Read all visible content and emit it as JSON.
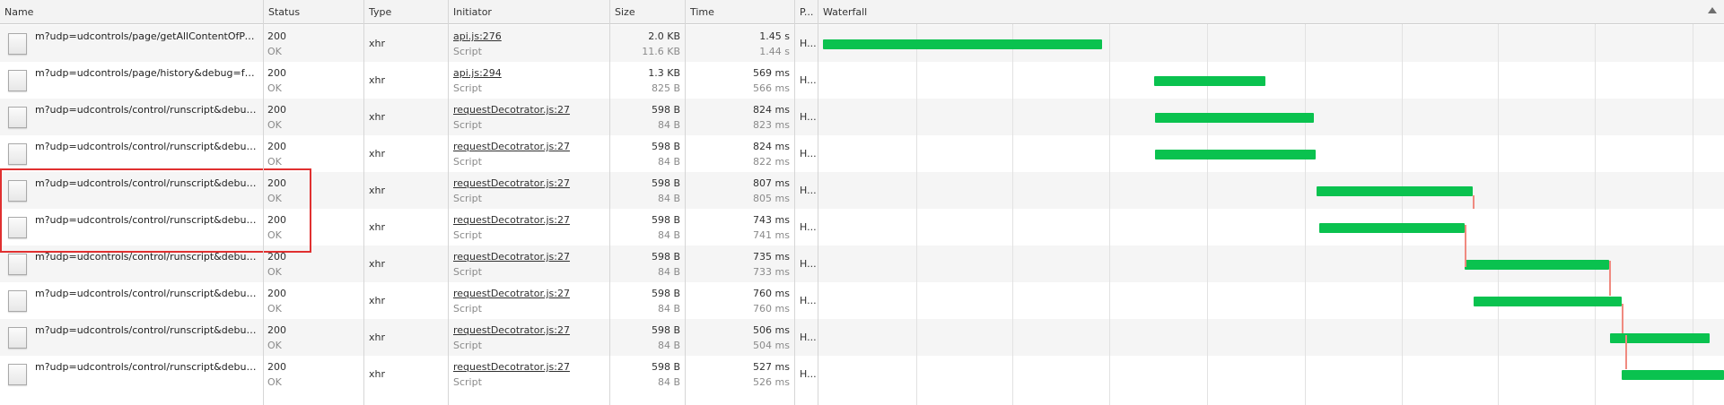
{
  "columns": {
    "name": "Name",
    "status": "Status",
    "type": "Type",
    "initiator": "Initiator",
    "size": "Size",
    "time": "Time",
    "priority": "P...",
    "waterfall": "Waterfall"
  },
  "icons": {
    "file": "document-icon",
    "sort": "sort-ascending-icon"
  },
  "colors": {
    "bar": "#0ac24f",
    "connector": "#f08a80",
    "highlight": "#e03030"
  },
  "requests": [
    {
      "name": "m?udp=udcontrols/page/getAllContentOfPa...",
      "status": "200",
      "status_text": "OK",
      "type": "xhr",
      "initiator": "api.js:276",
      "initiator_type": "Script",
      "size": "2.0 KB",
      "content": "11.6 KB",
      "time": "1.45 s",
      "latency": "1.44 s",
      "priority": "H..."
    },
    {
      "name": "m?udp=udcontrols/page/history&debug=fal...",
      "status": "200",
      "status_text": "OK",
      "type": "xhr",
      "initiator": "api.js:294",
      "initiator_type": "Script",
      "size": "1.3 KB",
      "content": "825 B",
      "time": "569 ms",
      "latency": "566 ms",
      "priority": "H..."
    },
    {
      "name": "m?udp=udcontrols/control/runscript&debug...",
      "status": "200",
      "status_text": "OK",
      "type": "xhr",
      "initiator": "requestDecotrator.js:27",
      "initiator_type": "Script",
      "size": "598 B",
      "content": "84 B",
      "time": "824 ms",
      "latency": "823 ms",
      "priority": "H..."
    },
    {
      "name": "m?udp=udcontrols/control/runscript&debug...",
      "status": "200",
      "status_text": "OK",
      "type": "xhr",
      "initiator": "requestDecotrator.js:27",
      "initiator_type": "Script",
      "size": "598 B",
      "content": "84 B",
      "time": "824 ms",
      "latency": "822 ms",
      "priority": "H..."
    },
    {
      "name": "m?udp=udcontrols/control/runscript&debug...",
      "status": "200",
      "status_text": "OK",
      "type": "xhr",
      "initiator": "requestDecotrator.js:27",
      "initiator_type": "Script",
      "size": "598 B",
      "content": "84 B",
      "time": "807 ms",
      "latency": "805 ms",
      "priority": "H..."
    },
    {
      "name": "m?udp=udcontrols/control/runscript&debug...",
      "status": "200",
      "status_text": "OK",
      "type": "xhr",
      "initiator": "requestDecotrator.js:27",
      "initiator_type": "Script",
      "size": "598 B",
      "content": "84 B",
      "time": "743 ms",
      "latency": "741 ms",
      "priority": "H..."
    },
    {
      "name": "m?udp=udcontrols/control/runscript&debug...",
      "status": "200",
      "status_text": "OK",
      "type": "xhr",
      "initiator": "requestDecotrator.js:27",
      "initiator_type": "Script",
      "size": "598 B",
      "content": "84 B",
      "time": "735 ms",
      "latency": "733 ms",
      "priority": "H..."
    },
    {
      "name": "m?udp=udcontrols/control/runscript&debug...",
      "status": "200",
      "status_text": "OK",
      "type": "xhr",
      "initiator": "requestDecotrator.js:27",
      "initiator_type": "Script",
      "size": "598 B",
      "content": "84 B",
      "time": "760 ms",
      "latency": "760 ms",
      "priority": "H..."
    },
    {
      "name": "m?udp=udcontrols/control/runscript&debug...",
      "status": "200",
      "status_text": "OK",
      "type": "xhr",
      "initiator": "requestDecotrator.js:27",
      "initiator_type": "Script",
      "size": "598 B",
      "content": "84 B",
      "time": "506 ms",
      "latency": "504 ms",
      "priority": "H..."
    },
    {
      "name": "m?udp=udcontrols/control/runscript&debug...",
      "status": "200",
      "status_text": "OK",
      "type": "xhr",
      "initiator": "requestDecotrator.js:27",
      "initiator_type": "Script",
      "size": "598 B",
      "content": "84 B",
      "time": "527 ms",
      "latency": "526 ms",
      "priority": "H..."
    }
  ]
}
